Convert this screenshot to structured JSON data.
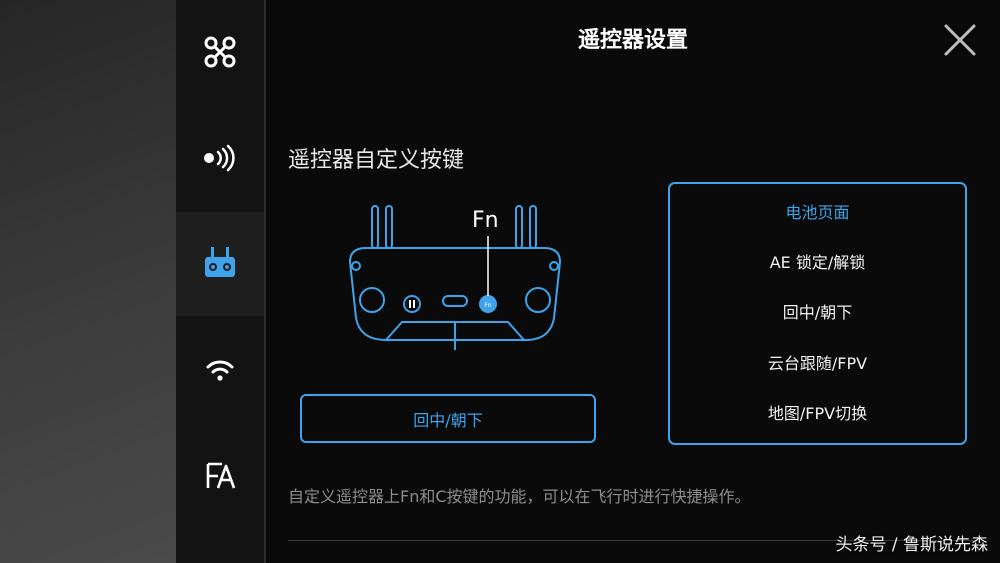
{
  "header": {
    "title": "遥控器设置"
  },
  "sidebar": {
    "items": [
      {
        "icon": "drone-icon"
      },
      {
        "icon": "signal-icon"
      },
      {
        "icon": "remote-controller-icon",
        "active": true
      },
      {
        "icon": "wifi-icon"
      },
      {
        "icon": "language-icon"
      }
    ]
  },
  "section": {
    "title": "遥控器自定义按键",
    "fn_label": "Fn",
    "assigned_value": "回中/朝下",
    "hint": "自定义遥控器上Fn和C按键的功能，可以在飞行时进行快捷操作。"
  },
  "options": [
    {
      "label": "电池页面",
      "selected": true
    },
    {
      "label": "AE 锁定/解锁",
      "selected": false
    },
    {
      "label": "回中/朝下",
      "selected": false
    },
    {
      "label": "云台跟随/FPV",
      "selected": false
    },
    {
      "label": "地图/FPV切换",
      "selected": false
    }
  ],
  "watermark": "头条号 / 鲁斯说先森",
  "colors": {
    "accent": "#3ea3ea",
    "background": "#0a0a0a",
    "rail": "#131313"
  }
}
